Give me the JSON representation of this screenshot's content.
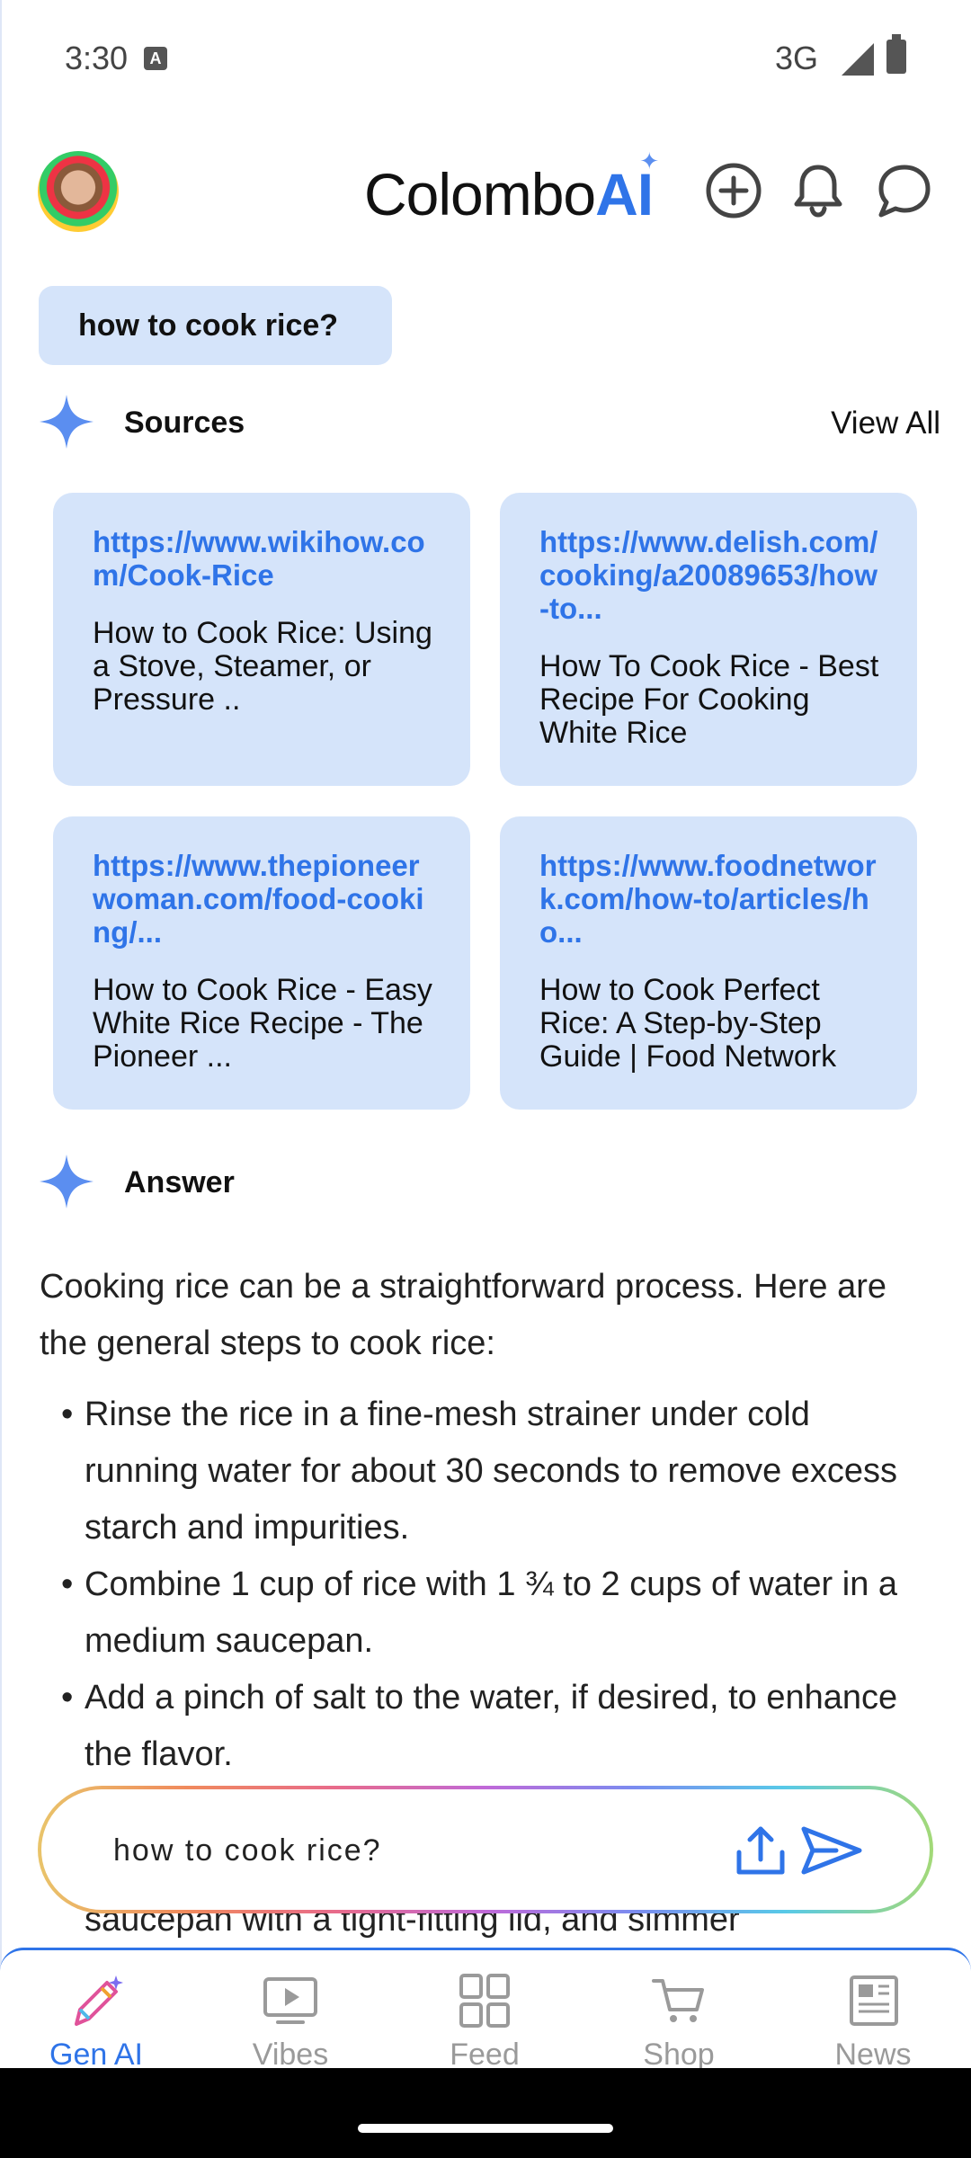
{
  "status_bar": {
    "time": "3:30",
    "network": "3G"
  },
  "header": {
    "app_name_part1": "Colombo",
    "app_name_part2": "AI"
  },
  "query": {
    "text": "how to cook rice?"
  },
  "sources": {
    "heading": "Sources",
    "view_all": "View All",
    "items": [
      {
        "url": "https://www.wikihow.com/Cook-Rice",
        "title": "How to Cook Rice: Using a Stove, Steamer, or Pressure .."
      },
      {
        "url": "https://www.delish.com/cooking/a20089653/how-to...",
        "title": "How To Cook Rice - Best Recipe For Cooking White Rice"
      },
      {
        "url": "https://www.thepioneerwoman.com/food-cooking/...",
        "title": "How to Cook Rice - Easy White Rice Recipe - The Pioneer ..."
      },
      {
        "url": "https://www.foodnetwork.com/how-to/articles/ho...",
        "title": "How to Cook Perfect Rice: A Step-by-Step Guide | Food Network"
      }
    ]
  },
  "answer": {
    "heading": "Answer",
    "intro": "Cooking rice can be a straightforward process. Here are the general steps to cook rice:",
    "steps": [
      "Rinse the rice in a fine-mesh strainer under cold running water for about 30 seconds to remove excess starch and impurities.",
      "Combine 1 cup of rice with 1 ¾ to 2 cups of water in a medium saucepan.",
      "Add a pinch of salt to the water, if desired, to enhance the flavor."
    ],
    "peek": "saucepan with a tight-fitting lid, and simmer"
  },
  "input": {
    "value": "how to cook rice?"
  },
  "nav": {
    "items": [
      {
        "label": "Gen AI"
      },
      {
        "label": "Vibes"
      },
      {
        "label": "Feed"
      },
      {
        "label": "Shop"
      },
      {
        "label": "News"
      }
    ]
  },
  "colors": {
    "accent": "#2f74e8",
    "chip_bg": "#d5e4fa",
    "inactive": "#9a9a9a"
  }
}
